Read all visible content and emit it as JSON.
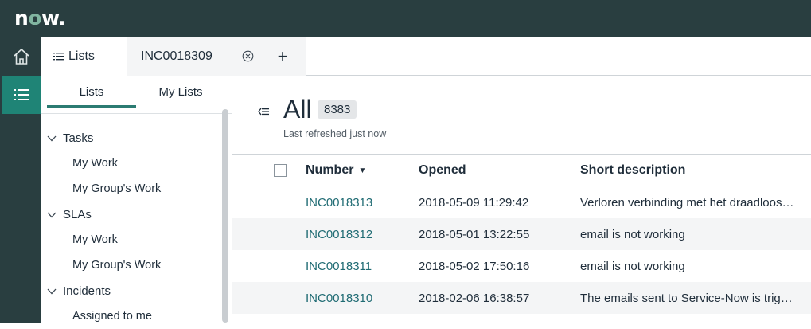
{
  "app": {
    "logo_prefix": "n",
    "logo_o": "o",
    "logo_suffix": "w",
    "logo_dot": "."
  },
  "tabs": {
    "lists_label": "Lists",
    "record_label": "INC0018309",
    "add_label": "+"
  },
  "sidebar": {
    "tab_lists": "Lists",
    "tab_my_lists": "My Lists",
    "groups": [
      {
        "label": "Tasks",
        "items": [
          "My Work",
          "My Group's Work"
        ]
      },
      {
        "label": "SLAs",
        "items": [
          "My Work",
          "My Group's Work"
        ]
      },
      {
        "label": "Incidents",
        "items": [
          "Assigned to me"
        ]
      }
    ]
  },
  "main": {
    "title": "All",
    "count": "8383",
    "refreshed": "Last refreshed just now",
    "columns": {
      "number": "Number",
      "opened": "Opened",
      "short_description": "Short description"
    },
    "rows": [
      {
        "number": "INC0018313",
        "opened": "2018-05-09 11:29:42",
        "short_description": "Verloren verbinding met het draadloos netwerk"
      },
      {
        "number": "INC0018312",
        "opened": "2018-05-01 13:22:55",
        "short_description": "email is not working"
      },
      {
        "number": "INC0018311",
        "opened": "2018-05-02 17:50:16",
        "short_description": "email is not working"
      },
      {
        "number": "INC0018310",
        "opened": "2018-02-06 16:38:57",
        "short_description": "The emails sent to Service-Now is triggering"
      }
    ]
  },
  "colors": {
    "header": "#293e40",
    "accent": "#1f8476",
    "link": "#1f6b73"
  },
  "icons": {
    "home": "home-icon",
    "list": "list-icon",
    "close": "close-circle-icon",
    "filter": "collapse-filter-icon"
  }
}
